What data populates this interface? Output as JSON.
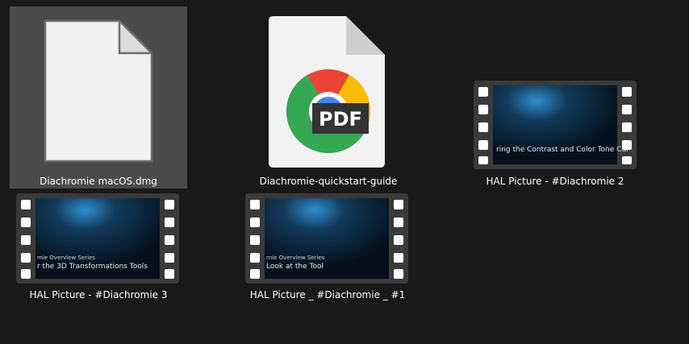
{
  "files": [
    {
      "name": "Diachromie macOS.dmg",
      "icon": "blank-file-icon",
      "selected": true
    },
    {
      "name": "Diachromie-quickstart-guide",
      "icon": "chrome-pdf-file-icon",
      "badge": "PDF"
    },
    {
      "name": "HAL Picture - #Diachromie 2",
      "icon": "video-file-icon",
      "thumb": {
        "line1": "",
        "line2": "ring the Contrast and Color Tone Cur"
      }
    },
    {
      "name": "HAL Picture - #Diachromie 3",
      "icon": "video-file-icon",
      "thumb": {
        "line1": "mie Overview Series",
        "line2": "r the 3D Transformations Tools"
      }
    },
    {
      "name": "HAL Picture _ #Diachromie  _ #1",
      "icon": "video-file-icon",
      "thumb": {
        "line1": "rnie Overview Series",
        "line2": "Look at the Tool"
      }
    }
  ],
  "colors": {
    "background": "#191919",
    "selection": "#4a4a4a",
    "label": "#ffffff"
  }
}
